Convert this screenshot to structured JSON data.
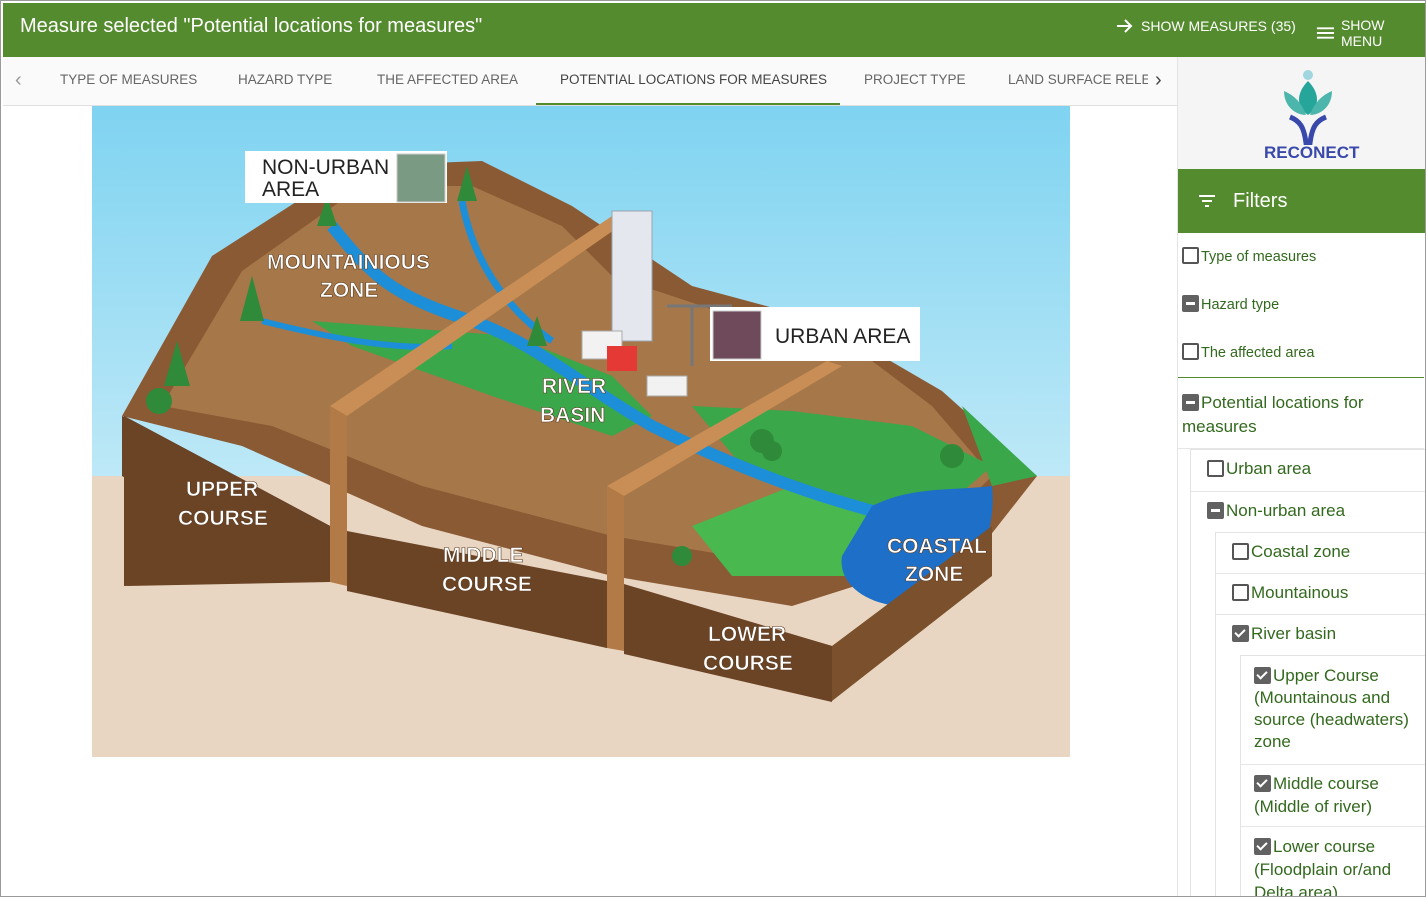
{
  "header": {
    "title": "Measure selected \"Potential locations for measures\"",
    "show_measures": "SHOW MEASURES (35)",
    "show_menu": "SHOW MENU",
    "accent": "#558b2f"
  },
  "tabs": [
    {
      "label": "TYPE OF MEASURES"
    },
    {
      "label": "HAZARD TYPE"
    },
    {
      "label": "THE AFFECTED AREA"
    },
    {
      "label": "POTENTIAL LOCATIONS FOR MEASURES",
      "active": true
    },
    {
      "label": "PROJECT TYPE"
    },
    {
      "label": "LAND SURFACE RELEVANCE"
    }
  ],
  "illustration": {
    "legend_non_urban": [
      "NON-URBAN",
      "AREA"
    ],
    "legend_urban": "URBAN AREA",
    "non_urban_color": "#7a9a84",
    "urban_color": "#6e4a5a",
    "labels": {
      "mountainous": [
        "MOUNTAINIOUS",
        "ZONE"
      ],
      "river_basin": [
        "RIVER",
        "BASIN"
      ],
      "upper": [
        "UPPER",
        "COURSE"
      ],
      "middle": [
        "MIDDLE",
        "COURSE"
      ],
      "lower": [
        "LOWER",
        "COURSE"
      ],
      "coastal": [
        "COASTAL",
        "ZONE"
      ]
    }
  },
  "sidebar": {
    "logo_text": "RECONECT",
    "filters_title": "Filters",
    "items": [
      {
        "label": "Type of measures",
        "state": "unchecked"
      },
      {
        "label": "Hazard type",
        "state": "indeterminate"
      },
      {
        "label": "The affected area",
        "state": "unchecked"
      },
      {
        "label": "Potential locations for measures",
        "state": "indeterminate"
      }
    ],
    "location_items": [
      {
        "label": "Urban area",
        "state": "unchecked"
      },
      {
        "label": "Non-urban area",
        "state": "indeterminate"
      },
      {
        "label": "Coastal zone",
        "state": "unchecked"
      },
      {
        "label": "Mountainous",
        "state": "unchecked"
      },
      {
        "label": "River basin",
        "state": "checked"
      },
      {
        "label": "Upper Course (Mountainous and source (headwaters) zone",
        "state": "checked"
      },
      {
        "label": "Middle course (Middle of river)",
        "state": "checked"
      },
      {
        "label": "Lower course (Floodplain or/and Delta area)",
        "state": "checked"
      }
    ]
  }
}
